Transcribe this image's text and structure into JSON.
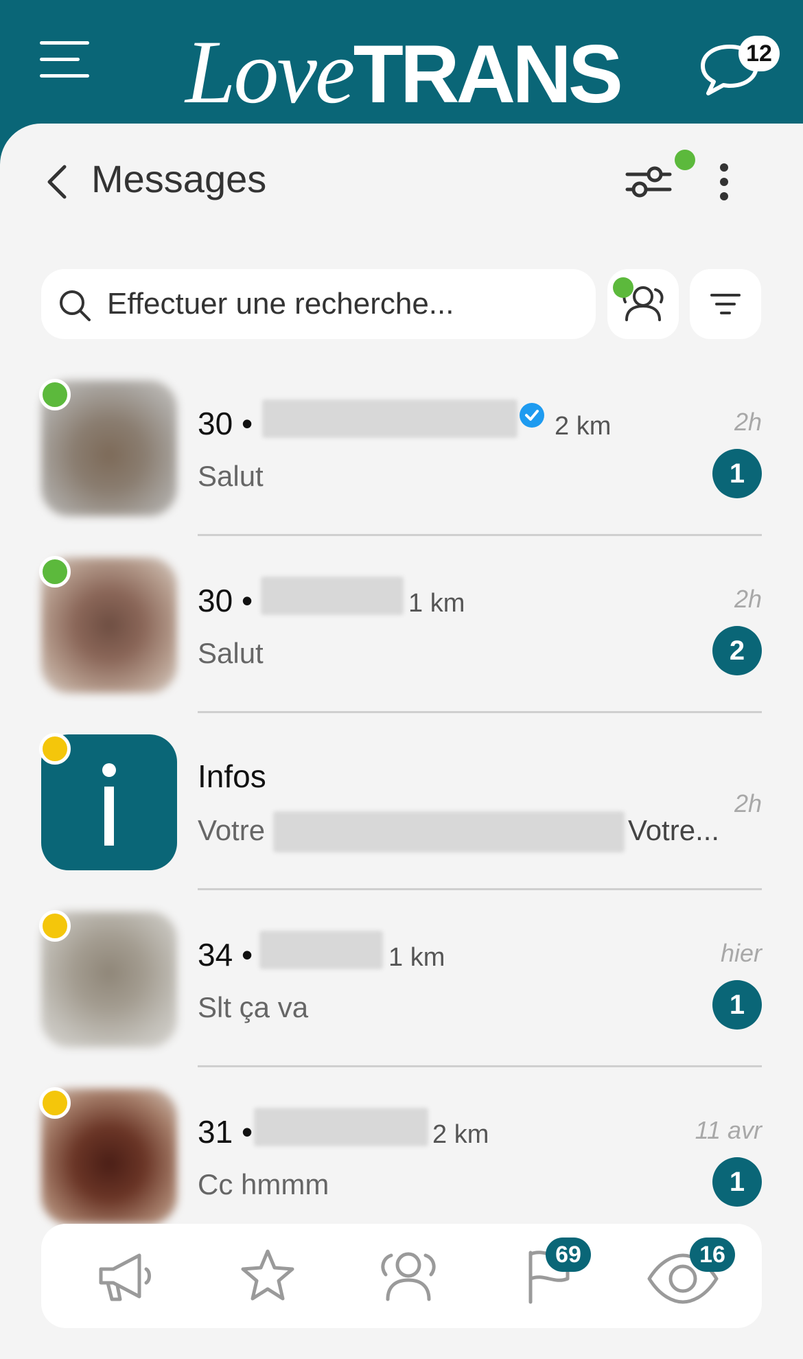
{
  "app": {
    "logo_script": "Love",
    "logo_bold": "TRANS",
    "chat_badge": "12"
  },
  "header": {
    "title": "Messages"
  },
  "search": {
    "placeholder": "Effectuer une recherche..."
  },
  "conversations": [
    {
      "age": "30 •",
      "distance": "2 km",
      "message": "Salut",
      "time": "2h",
      "unread": "1",
      "status": "online",
      "verified": true
    },
    {
      "age": "30 •",
      "distance": "1 km",
      "message": "Salut",
      "time": "2h",
      "unread": "2",
      "status": "online",
      "verified": false
    },
    {
      "title": "Infos",
      "message_start": "Votre",
      "message_end": "Votre...",
      "time": "2h",
      "status": "away"
    },
    {
      "age": "34 •",
      "distance": "1 km",
      "message": "Slt ça va",
      "time": "hier",
      "unread": "1",
      "status": "away",
      "verified": false
    },
    {
      "age": "31 •",
      "distance": "2 km",
      "message": "Cc hmmm",
      "time": "11 avr",
      "unread": "1",
      "status": "away",
      "verified": false
    }
  ],
  "bottom_nav": {
    "items": [
      {
        "icon": "megaphone-icon"
      },
      {
        "icon": "star-icon"
      },
      {
        "icon": "users-icon"
      },
      {
        "icon": "flag-icon",
        "badge": "69"
      },
      {
        "icon": "eye-icon",
        "badge": "16"
      }
    ]
  },
  "colors": {
    "brand": "#0a6677",
    "online": "#5cb93c",
    "away": "#f4c60b",
    "background": "#f4f4f4"
  }
}
